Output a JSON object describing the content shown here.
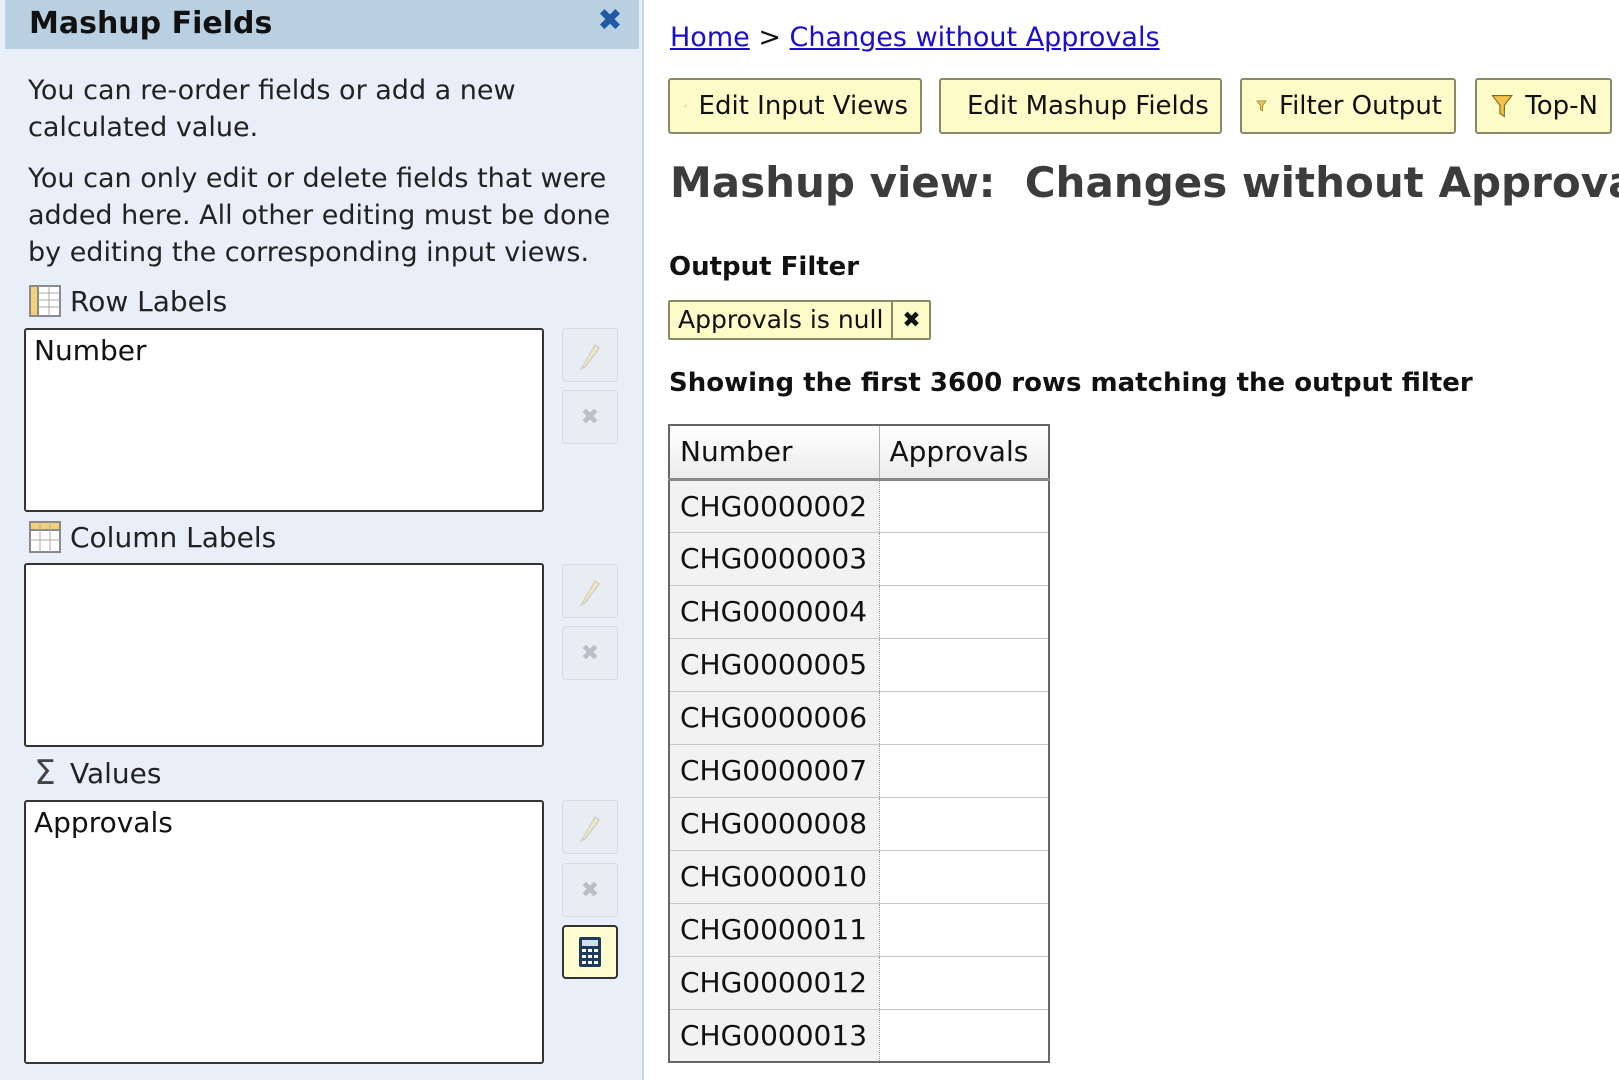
{
  "panel": {
    "title": "Mashup Fields",
    "help1": "You can re-order fields or add a new calculated value.",
    "help2": "You can only edit or delete fields that were added here. All other editing must be done by editing the corresponding input views.",
    "row_labels": {
      "label": "Row Labels",
      "items": [
        "Number"
      ]
    },
    "column_labels": {
      "label": "Column Labels",
      "items": []
    },
    "values": {
      "label": "Values",
      "items": [
        "Approvals"
      ]
    }
  },
  "breadcrumb": {
    "home": "Home",
    "sep": ">",
    "current": "Changes without Approvals"
  },
  "toolbar": {
    "edit_input_views": "Edit Input Views",
    "edit_mashup_fields": "Edit Mashup Fields",
    "filter_output": "Filter Output",
    "top_n": "Top-N"
  },
  "view_title": "Mashup view:  Changes without Approvals",
  "output_filter": {
    "heading": "Output Filter",
    "chip": "Approvals is null"
  },
  "showing_text": "Showing the first 3600 rows matching the output filter",
  "table": {
    "columns": [
      "Number",
      "Approvals"
    ],
    "rows": [
      [
        "CHG0000002",
        ""
      ],
      [
        "CHG0000003",
        ""
      ],
      [
        "CHG0000004",
        ""
      ],
      [
        "CHG0000005",
        ""
      ],
      [
        "CHG0000006",
        ""
      ],
      [
        "CHG0000007",
        ""
      ],
      [
        "CHG0000008",
        ""
      ],
      [
        "CHG0000010",
        ""
      ],
      [
        "CHG0000011",
        ""
      ],
      [
        "CHG0000012",
        ""
      ],
      [
        "CHG0000013",
        ""
      ]
    ]
  },
  "colors": {
    "panel_bg": "#e8eff8",
    "header_bg": "#b9cfe2",
    "button_bg": "#fdfbc8",
    "link": "#1a0dcc",
    "close_icon": "#1f5aa6"
  },
  "icons": [
    "close-icon",
    "row-labels-icon",
    "column-labels-icon",
    "sigma-icon",
    "pencil-icon",
    "delete-icon",
    "calculator-icon",
    "funnel-icon"
  ]
}
